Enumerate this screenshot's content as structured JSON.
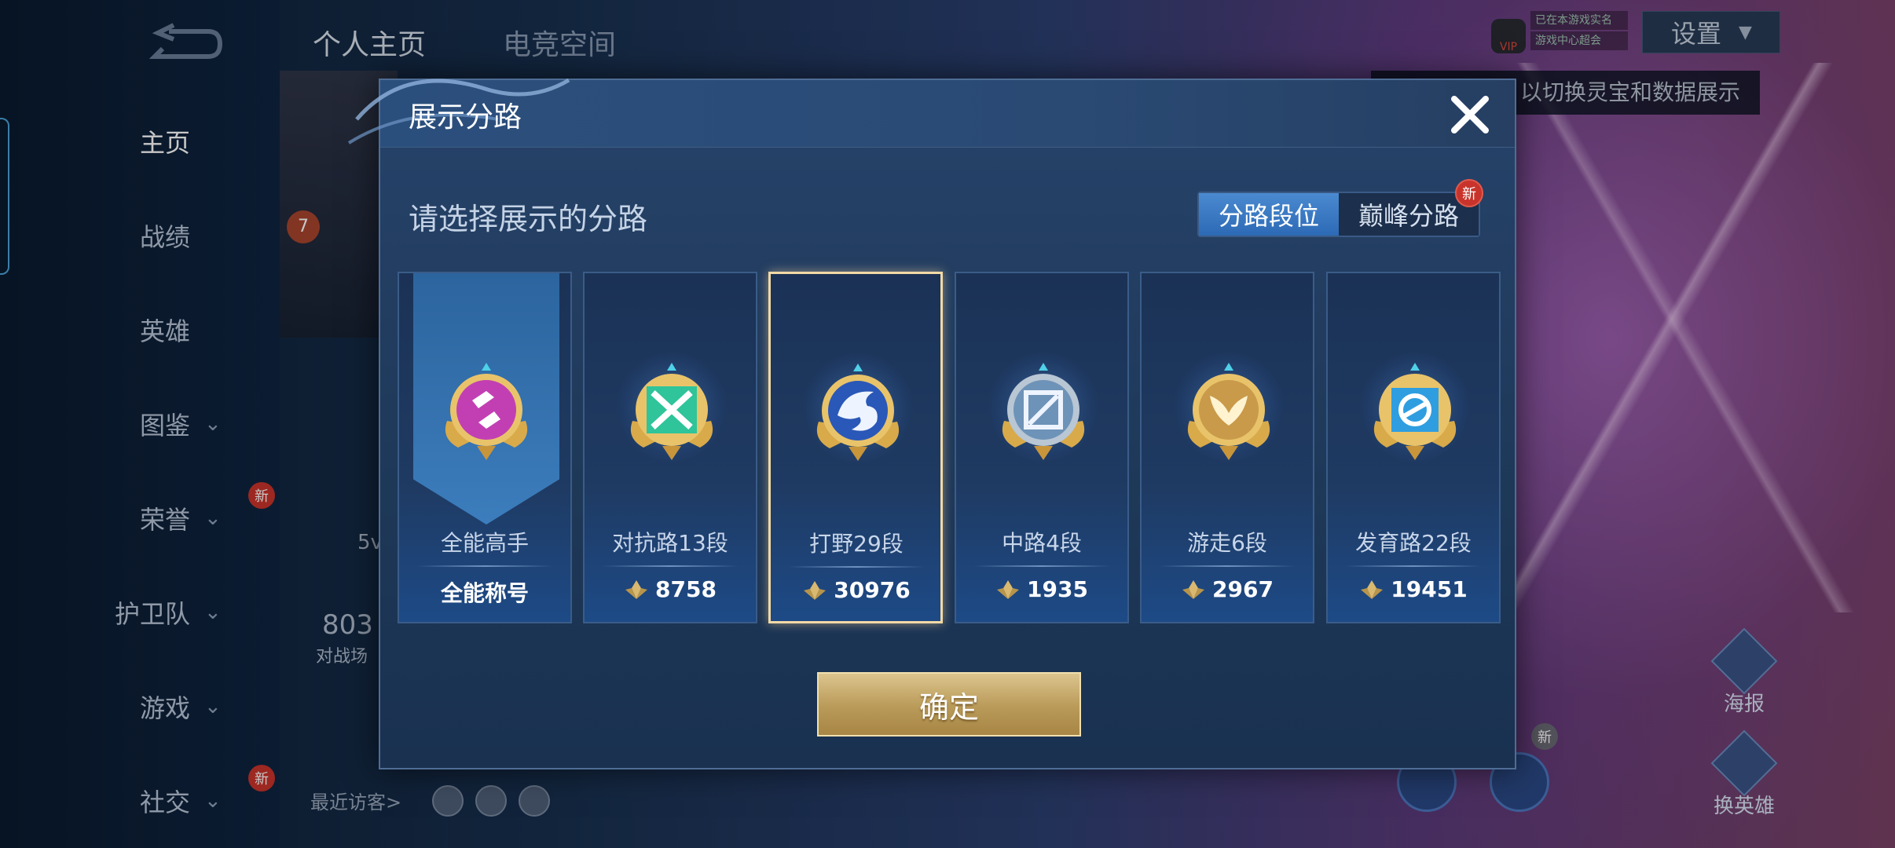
{
  "sidebar": {
    "items": [
      {
        "label": "主页",
        "active": true,
        "has_chevron": false,
        "new": false
      },
      {
        "label": "战绩",
        "active": false,
        "has_chevron": false,
        "new": false
      },
      {
        "label": "英雄",
        "active": false,
        "has_chevron": false,
        "new": false
      },
      {
        "label": "图鉴",
        "active": false,
        "has_chevron": true,
        "new": false
      },
      {
        "label": "荣誉",
        "active": false,
        "has_chevron": true,
        "new": true
      },
      {
        "label": "护卫队",
        "active": false,
        "has_chevron": true,
        "new": false
      },
      {
        "label": "游戏",
        "active": false,
        "has_chevron": true,
        "new": false
      },
      {
        "label": "社交",
        "active": false,
        "has_chevron": true,
        "new": true
      }
    ],
    "new_label": "新"
  },
  "top_tabs": [
    "个人主页",
    "电竞空间"
  ],
  "background": {
    "level": "7",
    "partial_text_1": "5v",
    "partial_text_2": "803",
    "partial_text_3": "对战场",
    "recent_visitors": "最近访客>"
  },
  "top_right": {
    "vip_label": "VIP",
    "qq_line_1": "已在本游戏实名",
    "qq_line_2": "游戏中心超会",
    "settings_label": "设置",
    "tip_text": "以切换灵宝和数据展示"
  },
  "right_actions": {
    "poster_label": "海报",
    "change_hero_label": "换英雄",
    "new_label": "新"
  },
  "modal": {
    "title": "展示分路",
    "subtitle": "请选择展示的分路",
    "tabs": [
      {
        "label": "分路段位",
        "active": true
      },
      {
        "label": "巅峰分路",
        "active": false,
        "new": "新"
      }
    ],
    "cards": [
      {
        "name": "全能高手",
        "value": "全能称号",
        "emblem": "all-round-emblem-icon",
        "color": "#c23fb3",
        "selected": false,
        "has_ribbon": true,
        "has_score_icon": false
      },
      {
        "name": "对抗路13段",
        "value": "8758",
        "emblem": "clash-lane-emblem-icon",
        "color": "#2fc49a",
        "selected": false,
        "has_ribbon": false,
        "has_score_icon": true
      },
      {
        "name": "打野29段",
        "value": "30976",
        "emblem": "jungle-dragon-emblem-icon",
        "color": "#2a58b8",
        "selected": true,
        "has_ribbon": false,
        "has_score_icon": true
      },
      {
        "name": "中路4段",
        "value": "1935",
        "emblem": "mid-lane-emblem-icon",
        "color": "#6e93b8",
        "selected": false,
        "has_ribbon": false,
        "has_score_icon": true
      },
      {
        "name": "游走6段",
        "value": "2967",
        "emblem": "roam-wings-emblem-icon",
        "color": "#c99a4a",
        "selected": false,
        "has_ribbon": false,
        "has_score_icon": true
      },
      {
        "name": "发育路22段",
        "value": "19451",
        "emblem": "farm-lane-emblem-icon",
        "color": "#2f9ee0",
        "selected": false,
        "has_ribbon": false,
        "has_score_icon": true
      }
    ],
    "confirm_label": "确定"
  }
}
